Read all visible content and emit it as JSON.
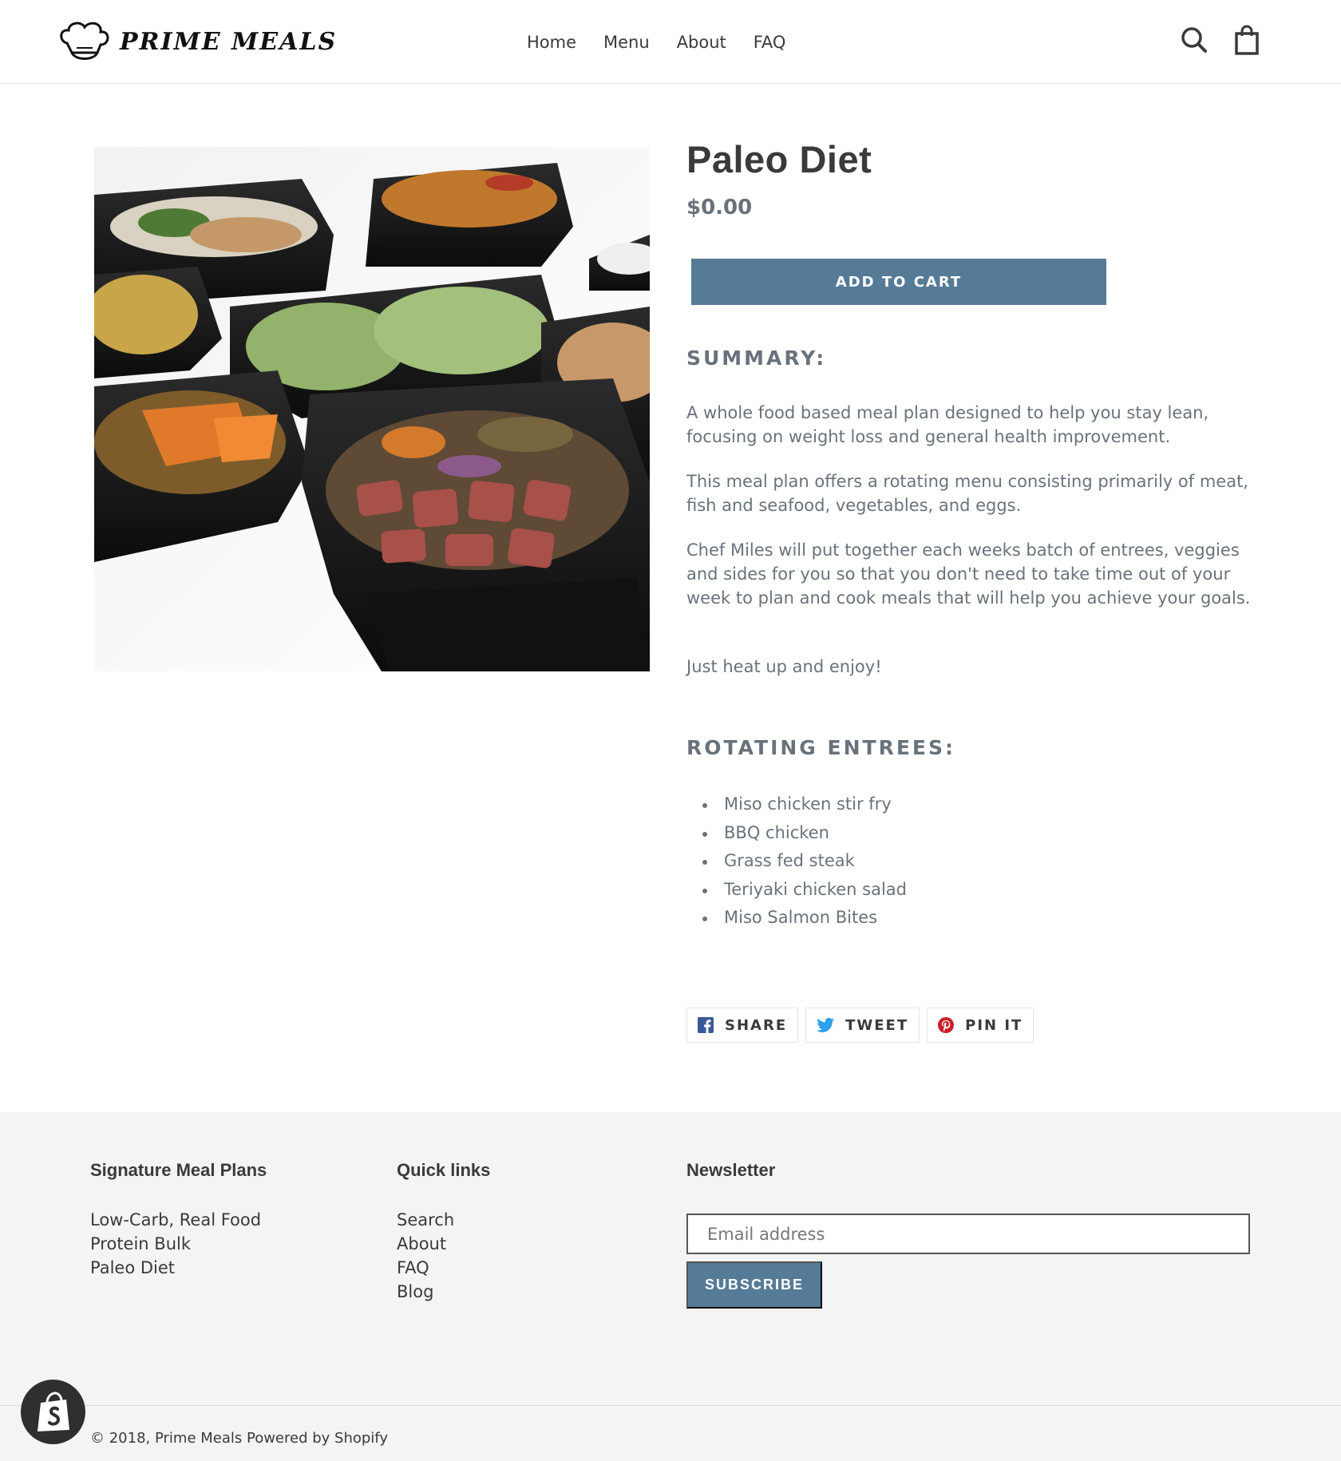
{
  "header": {
    "logo_text": "PRIME MEALS",
    "nav": [
      "Home",
      "Menu",
      "About",
      "FAQ"
    ],
    "search_icon": "search-icon",
    "cart_icon": "cart-icon"
  },
  "product": {
    "title": "Paleo Diet",
    "price": "$0.00",
    "add_to_cart": "ADD TO CART",
    "summary_heading": "SUMMARY:",
    "paragraphs": [
      "A whole food based meal plan designed to help you stay lean, focusing on weight loss and general health improvement.",
      "This meal plan offers a rotating menu consisting primarily of meat, fish and seafood, vegetables, and eggs.",
      "Chef Miles will put together each weeks batch of entrees, veggies and sides for you so that you don't need to take time out of your week to plan and cook meals that will help you achieve your goals.",
      "Just heat up and enjoy!"
    ],
    "entrees_heading": "ROTATING ENTREES:",
    "entrees": [
      "Miso chicken stir fry",
      "BBQ chicken",
      "Grass fed steak",
      "Teriyaki chicken salad",
      "Miso Salmon Bites"
    ],
    "share": [
      "SHARE",
      "TWEET",
      "PIN IT"
    ]
  },
  "footer": {
    "col1_heading": "Signature Meal Plans",
    "col1_links": [
      "Low-Carb, Real Food",
      "Protein Bulk",
      "Paleo Diet"
    ],
    "col2_heading": "Quick links",
    "col2_links": [
      "Search",
      "About",
      "FAQ",
      "Blog"
    ],
    "newsletter_heading": "Newsletter",
    "email_placeholder": "Email address",
    "subscribe": "SUBSCRIBE",
    "copyright": "© 2018, Prime Meals Powered by Shopify"
  },
  "colors": {
    "accent": "#557b97",
    "text_muted": "#69727b",
    "footer_bg": "#f4f4f4"
  }
}
